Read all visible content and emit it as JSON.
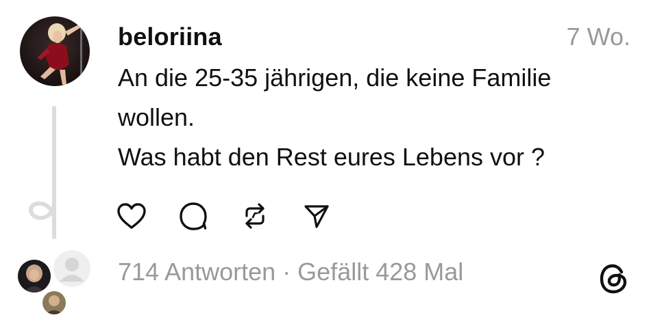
{
  "post": {
    "username": "beloriina",
    "timestamp": "7 Wo.",
    "lines": [
      "An die 25-35 jährigen, die keine Familie",
      "wollen.",
      "Was habt den Rest eures Lebens vor ?"
    ]
  },
  "actions": [
    {
      "name": "like-button",
      "icon": "heart-icon"
    },
    {
      "name": "comment-button",
      "icon": "comment-bubble-icon"
    },
    {
      "name": "repost-button",
      "icon": "repost-icon"
    },
    {
      "name": "share-button",
      "icon": "send-icon"
    }
  ],
  "stats": {
    "replies": "714 Antworten",
    "separator": " · ",
    "likes": "Gefällt 428 Mal"
  },
  "colors": {
    "text": "#101010",
    "muted": "#999999",
    "line": "#dcdcdc",
    "avatar_dress": "#8b0e1c"
  },
  "branding": {
    "logo_icon": "threads-logo-icon"
  }
}
